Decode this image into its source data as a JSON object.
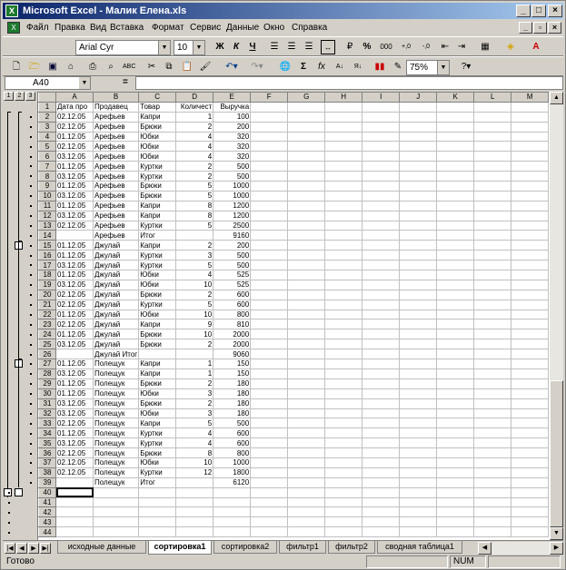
{
  "window": {
    "title": "Microsoft Excel - Малик Елена.xls",
    "icon": "excel-icon"
  },
  "menu": [
    "Файл",
    "Правка",
    "Вид",
    "Вставка",
    "Формат",
    "Сервис",
    "Данные",
    "Окно",
    "Справка"
  ],
  "format_toolbar": {
    "font": "Arial Cyr",
    "size": "10",
    "bold": "Ж",
    "italic": "К",
    "underline": "Ч",
    "percent": "%",
    "thousands": "000",
    "inc_dec": ",00→,0",
    "dec_dec": ",00←,0"
  },
  "std_toolbar": {
    "zoom": "75%"
  },
  "formula_bar": {
    "name_box": "A40",
    "eq": "=",
    "formula": ""
  },
  "columns": [
    "A",
    "B",
    "C",
    "D",
    "E",
    "F",
    "G",
    "H",
    "I",
    "J",
    "K",
    "L",
    "M"
  ],
  "outline_levels": [
    "1",
    "2",
    "3"
  ],
  "rows": [
    {
      "n": "1",
      "a": "Дата про",
      "b": "Продавец",
      "c": "Товар",
      "d": "Количест",
      "e": "Выручка"
    },
    {
      "n": "2",
      "a": "02.12.05",
      "b": "Арефьев",
      "c": "Капри",
      "d": "1",
      "e": "100"
    },
    {
      "n": "3",
      "a": "02.12.05",
      "b": "Арефьев",
      "c": "Брюки",
      "d": "2",
      "e": "200"
    },
    {
      "n": "4",
      "a": "01.12.05",
      "b": "Арефьев",
      "c": "Юбки",
      "d": "4",
      "e": "320"
    },
    {
      "n": "5",
      "a": "02.12.05",
      "b": "Арефьев",
      "c": "Юбки",
      "d": "4",
      "e": "320"
    },
    {
      "n": "6",
      "a": "03.12.05",
      "b": "Арефьев",
      "c": "Юбки",
      "d": "4",
      "e": "320"
    },
    {
      "n": "7",
      "a": "01.12.05",
      "b": "Арефьев",
      "c": "Куртки",
      "d": "2",
      "e": "500"
    },
    {
      "n": "8",
      "a": "03.12.05",
      "b": "Арефьев",
      "c": "Куртки",
      "d": "2",
      "e": "500"
    },
    {
      "n": "9",
      "a": "01.12.05",
      "b": "Арефьев",
      "c": "Брюки",
      "d": "5",
      "e": "1000"
    },
    {
      "n": "10",
      "a": "03.12.05",
      "b": "Арефьев",
      "c": "Брюки",
      "d": "5",
      "e": "1000"
    },
    {
      "n": "11",
      "a": "01.12.05",
      "b": "Арефьев",
      "c": "Капри",
      "d": "8",
      "e": "1200"
    },
    {
      "n": "12",
      "a": "03.12.05",
      "b": "Арефьев",
      "c": "Капри",
      "d": "8",
      "e": "1200"
    },
    {
      "n": "13",
      "a": "02.12.05",
      "b": "Арефьев",
      "c": "Куртки",
      "d": "5",
      "e": "2500"
    },
    {
      "n": "14",
      "a": "",
      "b": "Арефьев",
      "c": "Итог",
      "d": "",
      "e": "9160"
    },
    {
      "n": "15",
      "a": "01.12.05",
      "b": "Джулай",
      "c": "Капри",
      "d": "2",
      "e": "200"
    },
    {
      "n": "16",
      "a": "01.12.05",
      "b": "Джулай",
      "c": "Куртки",
      "d": "3",
      "e": "500"
    },
    {
      "n": "17",
      "a": "03.12.05",
      "b": "Джулай",
      "c": "Куртки",
      "d": "5",
      "e": "500"
    },
    {
      "n": "18",
      "a": "01.12.05",
      "b": "Джулай",
      "c": "Юбки",
      "d": "4",
      "e": "525"
    },
    {
      "n": "19",
      "a": "03.12.05",
      "b": "Джулай",
      "c": "Юбки",
      "d": "10",
      "e": "525"
    },
    {
      "n": "20",
      "a": "02.12.05",
      "b": "Джулай",
      "c": "Брюки",
      "d": "2",
      "e": "600"
    },
    {
      "n": "21",
      "a": "02.12.05",
      "b": "Джулай",
      "c": "Куртки",
      "d": "5",
      "e": "600"
    },
    {
      "n": "22",
      "a": "01.12.05",
      "b": "Джулай",
      "c": "Юбки",
      "d": "10",
      "e": "800"
    },
    {
      "n": "23",
      "a": "02.12.05",
      "b": "Джулай",
      "c": "Капри",
      "d": "9",
      "e": "810"
    },
    {
      "n": "24",
      "a": "01.12.05",
      "b": "Джулай",
      "c": "Брюки",
      "d": "10",
      "e": "2000"
    },
    {
      "n": "25",
      "a": "03.12.05",
      "b": "Джулай",
      "c": "Брюки",
      "d": "2",
      "e": "2000"
    },
    {
      "n": "26",
      "a": "",
      "b": "Джулай Итог",
      "c": "",
      "d": "",
      "e": "9060"
    },
    {
      "n": "27",
      "a": "01.12.05",
      "b": "Полещук",
      "c": "Капри",
      "d": "1",
      "e": "150"
    },
    {
      "n": "28",
      "a": "03.12.05",
      "b": "Полещук",
      "c": "Капри",
      "d": "1",
      "e": "150"
    },
    {
      "n": "29",
      "a": "01.12.05",
      "b": "Полещук",
      "c": "Брюки",
      "d": "2",
      "e": "180"
    },
    {
      "n": "30",
      "a": "01.12.05",
      "b": "Полещук",
      "c": "Юбки",
      "d": "3",
      "e": "180"
    },
    {
      "n": "31",
      "a": "03.12.05",
      "b": "Полещук",
      "c": "Брюки",
      "d": "2",
      "e": "180"
    },
    {
      "n": "32",
      "a": "03.12.05",
      "b": "Полещук",
      "c": "Юбки",
      "d": "3",
      "e": "180"
    },
    {
      "n": "33",
      "a": "02.12.05",
      "b": "Полещук",
      "c": "Капри",
      "d": "5",
      "e": "500"
    },
    {
      "n": "34",
      "a": "01.12.05",
      "b": "Полещук",
      "c": "Куртки",
      "d": "4",
      "e": "600"
    },
    {
      "n": "35",
      "a": "03.12.05",
      "b": "Полещук",
      "c": "Куртки",
      "d": "4",
      "e": "600"
    },
    {
      "n": "36",
      "a": "02.12.05",
      "b": "Полещук",
      "c": "Брюки",
      "d": "8",
      "e": "800"
    },
    {
      "n": "37",
      "a": "02.12.05",
      "b": "Полещук",
      "c": "Юбки",
      "d": "10",
      "e": "1000"
    },
    {
      "n": "38",
      "a": "02.12.05",
      "b": "Полещук",
      "c": "Куртки",
      "d": "12",
      "e": "1800"
    },
    {
      "n": "39",
      "a": "",
      "b": "Полещук",
      "c": "Итог",
      "d": "",
      "e": "6120"
    },
    {
      "n": "40",
      "a": "",
      "b": "",
      "c": "",
      "d": "",
      "e": ""
    },
    {
      "n": "41",
      "a": "",
      "b": "",
      "c": "",
      "d": "",
      "e": ""
    },
    {
      "n": "42",
      "a": "",
      "b": "",
      "c": "",
      "d": "",
      "e": ""
    },
    {
      "n": "43",
      "a": "",
      "b": "",
      "c": "",
      "d": "",
      "e": ""
    },
    {
      "n": "44",
      "a": "",
      "b": "",
      "c": "",
      "d": "",
      "e": ""
    }
  ],
  "sheet_tabs": [
    "исходные данные",
    "сортировка1",
    "сортировка2",
    "фильтр1",
    "фильтр2",
    "сводная таблица1"
  ],
  "active_tab": "сортировка1",
  "status": {
    "text": "Готово",
    "num": "NUM"
  }
}
